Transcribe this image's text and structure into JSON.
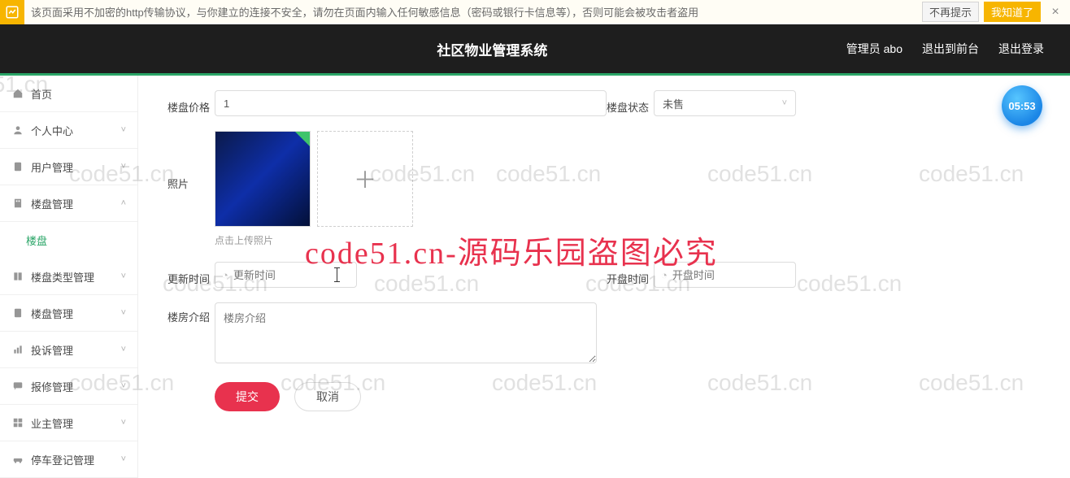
{
  "warning": {
    "text": "该页面采用不加密的http传输协议，与你建立的连接不安全，请勿在页面内输入任何敏感信息（密码或银行卡信息等），否则可能会被攻击者盗用",
    "btn_no_remind": "不再提示",
    "btn_know": "我知道了",
    "close": "×"
  },
  "header": {
    "app_title": "社区物业管理系统",
    "admin_label": "管理员 abo",
    "exit_front": "退出到前台",
    "exit_login": "退出登录"
  },
  "sidebar": {
    "items": [
      {
        "icon": "home",
        "label": "首页",
        "chev": ""
      },
      {
        "icon": "user",
        "label": "个人中心",
        "chev": "˅"
      },
      {
        "icon": "clipboard",
        "label": "用户管理",
        "chev": "˅"
      },
      {
        "icon": "building",
        "label": "楼盘管理",
        "chev": "˄",
        "expanded": true
      },
      {
        "icon": "",
        "label": "楼盘",
        "sub": true
      },
      {
        "icon": "tags",
        "label": "楼盘类型管理",
        "chev": "˅"
      },
      {
        "icon": "clipboard",
        "label": "楼盘管理",
        "chev": "˅"
      },
      {
        "icon": "bars",
        "label": "投诉管理",
        "chev": "˅"
      },
      {
        "icon": "chat",
        "label": "报修管理",
        "chev": "˅"
      },
      {
        "icon": "grid",
        "label": "业主管理",
        "chev": "˅"
      },
      {
        "icon": "car",
        "label": "停车登记管理",
        "chev": "˅"
      }
    ]
  },
  "form": {
    "price_label": "楼盘价格",
    "price_value": "1",
    "status_label": "楼盘状态",
    "status_value": "未售",
    "photo_label": "照片",
    "photo_hint": "点击上传照片",
    "update_time_label": "更新时间",
    "update_time_placeholder": "更新时间",
    "open_time_label": "开盘时间",
    "open_time_placeholder": "开盘时间",
    "desc_label": "楼房介绍",
    "desc_placeholder": "楼房介绍",
    "submit_btn": "提交",
    "cancel_btn": "取消"
  },
  "badge": {
    "time": "05:53"
  },
  "watermark": {
    "small": "code51.cn",
    "big": "code51.cn-源码乐园盗图必究"
  }
}
